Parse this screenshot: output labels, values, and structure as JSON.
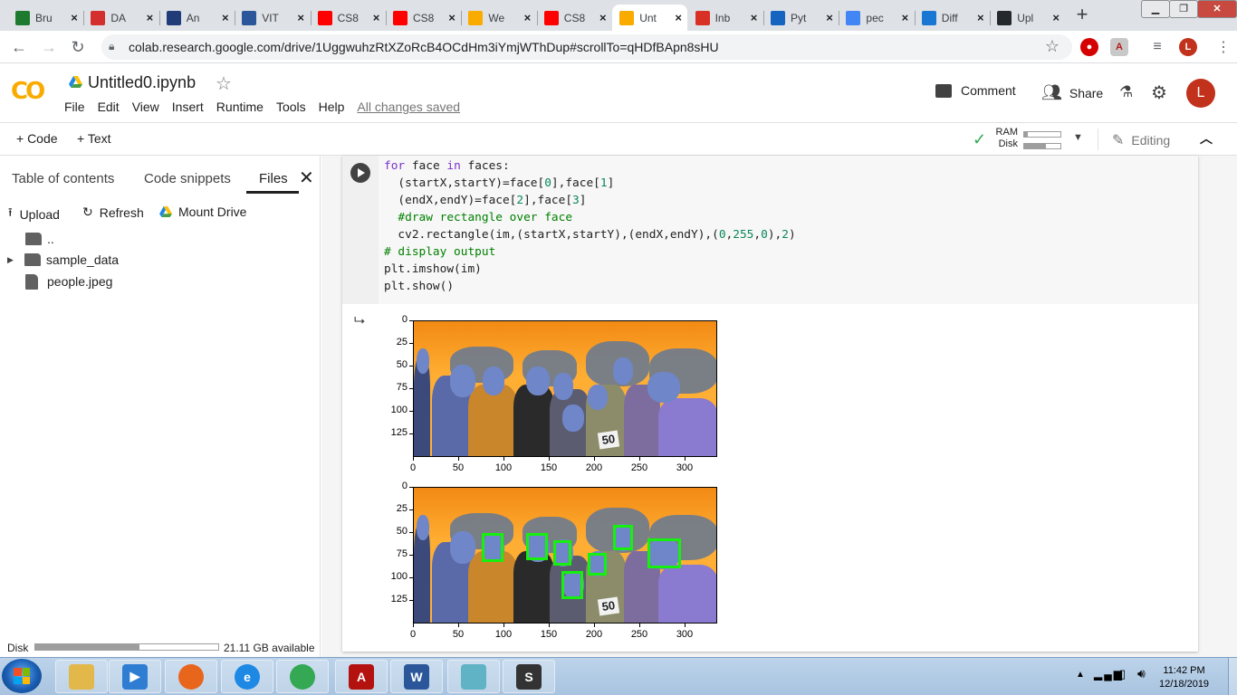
{
  "browser": {
    "tabs": [
      {
        "label": "Bru",
        "icon": "bruteforce-icon",
        "color": "#1e7a2e"
      },
      {
        "label": "DA",
        "icon": "vtu-icon",
        "color": "#d32f2f"
      },
      {
        "label": "An",
        "icon": "ieee-icon",
        "color": "#1f3c78"
      },
      {
        "label": "VIT",
        "icon": "word-icon",
        "color": "#2b579a"
      },
      {
        "label": "CS8",
        "icon": "youtube-icon",
        "color": "#ff0000"
      },
      {
        "label": "CS8",
        "icon": "youtube-icon",
        "color": "#ff0000"
      },
      {
        "label": "We",
        "icon": "colab-icon",
        "color": "#f9ab00"
      },
      {
        "label": "CS8",
        "icon": "youtube-icon",
        "color": "#ff0000"
      },
      {
        "label": "Unt",
        "icon": "colab-icon",
        "color": "#f9ab00",
        "active": true
      },
      {
        "label": "Inb",
        "icon": "gmail-icon",
        "color": "#d93025"
      },
      {
        "label": "Pyt",
        "icon": "pycharm-icon",
        "color": "#1565c0"
      },
      {
        "label": "pec",
        "icon": "google-icon",
        "color": "#4285f4"
      },
      {
        "label": "Diff",
        "icon": "diff-icon",
        "color": "#1976d2"
      },
      {
        "label": "Upl",
        "icon": "github-icon",
        "color": "#24292e"
      }
    ],
    "url": "colab.research.google.com/drive/1UggwuhzRtXZoRcB4OCdHm3iYmjWThDup#scrollTo=qHDfBApn8sHU",
    "profile_initial": "L"
  },
  "colab": {
    "title": "Untitled0.ipynb",
    "menu": [
      "File",
      "Edit",
      "View",
      "Insert",
      "Runtime",
      "Tools",
      "Help"
    ],
    "save_status": "All changes saved",
    "comment_label": "Comment",
    "share_label": "Share",
    "avatar_initial": "L",
    "add_code": "+ Code",
    "add_text": "+ Text",
    "ram_label": "RAM",
    "disk_label": "Disk",
    "ram_fraction": 0.1,
    "disk_fraction": 0.6,
    "editing_label": "Editing"
  },
  "sidebar": {
    "tabs": [
      "Table of contents",
      "Code snippets",
      "Files"
    ],
    "active_tab": "Files",
    "actions": [
      "Upload",
      "Refresh",
      "Mount Drive"
    ],
    "files": [
      {
        "name": "..",
        "type": "parent"
      },
      {
        "name": "sample_data",
        "type": "folder"
      },
      {
        "name": "people.jpeg",
        "type": "file"
      }
    ],
    "disk_label": "Disk",
    "disk_available": "21.11 GB available",
    "disk_fraction": 0.57
  },
  "code_lines": [
    {
      "parts": [
        {
          "t": "for",
          "c": "kw"
        },
        {
          "t": " face "
        },
        {
          "t": "in",
          "c": "kw"
        },
        {
          "t": " faces:"
        }
      ]
    },
    {
      "parts": [
        {
          "t": "  (startX,startY)=face["
        },
        {
          "t": "0",
          "c": "num"
        },
        {
          "t": "],face["
        },
        {
          "t": "1",
          "c": "num"
        },
        {
          "t": "]"
        }
      ]
    },
    {
      "parts": [
        {
          "t": "  (endX,endY)=face["
        },
        {
          "t": "2",
          "c": "num"
        },
        {
          "t": "],face["
        },
        {
          "t": "3",
          "c": "num"
        },
        {
          "t": "]"
        }
      ]
    },
    {
      "parts": [
        {
          "t": "  #draw rectangle over face",
          "c": "cm"
        }
      ]
    },
    {
      "parts": [
        {
          "t": "  cv2.rectangle(im,(startX,startY),(endX,endY),("
        },
        {
          "t": "0",
          "c": "num"
        },
        {
          "t": ","
        },
        {
          "t": "255",
          "c": "num"
        },
        {
          "t": ","
        },
        {
          "t": "0",
          "c": "num"
        },
        {
          "t": "),"
        },
        {
          "t": "2",
          "c": "num"
        },
        {
          "t": ")"
        }
      ]
    },
    {
      "parts": [
        {
          "t": "# display output",
          "c": "cm"
        }
      ]
    },
    {
      "parts": [
        {
          "t": "plt.imshow(im)"
        }
      ]
    },
    {
      "parts": [
        {
          "t": "plt.show()"
        }
      ]
    }
  ],
  "chart_data": [
    {
      "type": "image",
      "yticks": [
        "0",
        "25",
        "50",
        "75",
        "100",
        "125"
      ],
      "xticks": [
        "0",
        "50",
        "100",
        "150",
        "200",
        "250",
        "300"
      ],
      "xlim": [
        0,
        336
      ],
      "ylim": [
        151,
        0
      ],
      "jersey_number": "50"
    },
    {
      "type": "image",
      "yticks": [
        "0",
        "25",
        "50",
        "75",
        "100",
        "125"
      ],
      "xticks": [
        "0",
        "50",
        "100",
        "150",
        "200",
        "250",
        "300"
      ],
      "xlim": [
        0,
        336
      ],
      "ylim": [
        151,
        0
      ],
      "jersey_number": "50",
      "face_boxes": [
        {
          "x": 75,
          "y": 50,
          "w": 24,
          "h": 32
        },
        {
          "x": 124,
          "y": 50,
          "w": 24,
          "h": 30
        },
        {
          "x": 154,
          "y": 58,
          "w": 20,
          "h": 28
        },
        {
          "x": 163,
          "y": 92,
          "w": 24,
          "h": 31
        },
        {
          "x": 192,
          "y": 72,
          "w": 21,
          "h": 25
        },
        {
          "x": 220,
          "y": 41,
          "w": 22,
          "h": 28
        },
        {
          "x": 258,
          "y": 56,
          "w": 37,
          "h": 33
        }
      ]
    }
  ],
  "taskbar": {
    "apps": [
      {
        "name": "explorer-icon",
        "color": "#e2b84a",
        "label": ""
      },
      {
        "name": "media-player-icon",
        "color": "#2f7dd3",
        "label": "▶"
      },
      {
        "name": "firefox-icon",
        "color": "#e8651c",
        "label": ""
      },
      {
        "name": "ie-icon",
        "color": "#1e88e5",
        "label": "e"
      },
      {
        "name": "chrome-icon",
        "color": "#34a853",
        "label": ""
      },
      {
        "name": "acrobat-icon",
        "color": "#b3120f",
        "label": "A"
      },
      {
        "name": "word-icon",
        "color": "#2b579a",
        "label": "W"
      },
      {
        "name": "notepad-icon",
        "color": "#5fb3c5",
        "label": ""
      },
      {
        "name": "sublime-icon",
        "color": "#333",
        "label": "S"
      }
    ],
    "time": "11:42 PM",
    "date": "12/18/2019"
  }
}
